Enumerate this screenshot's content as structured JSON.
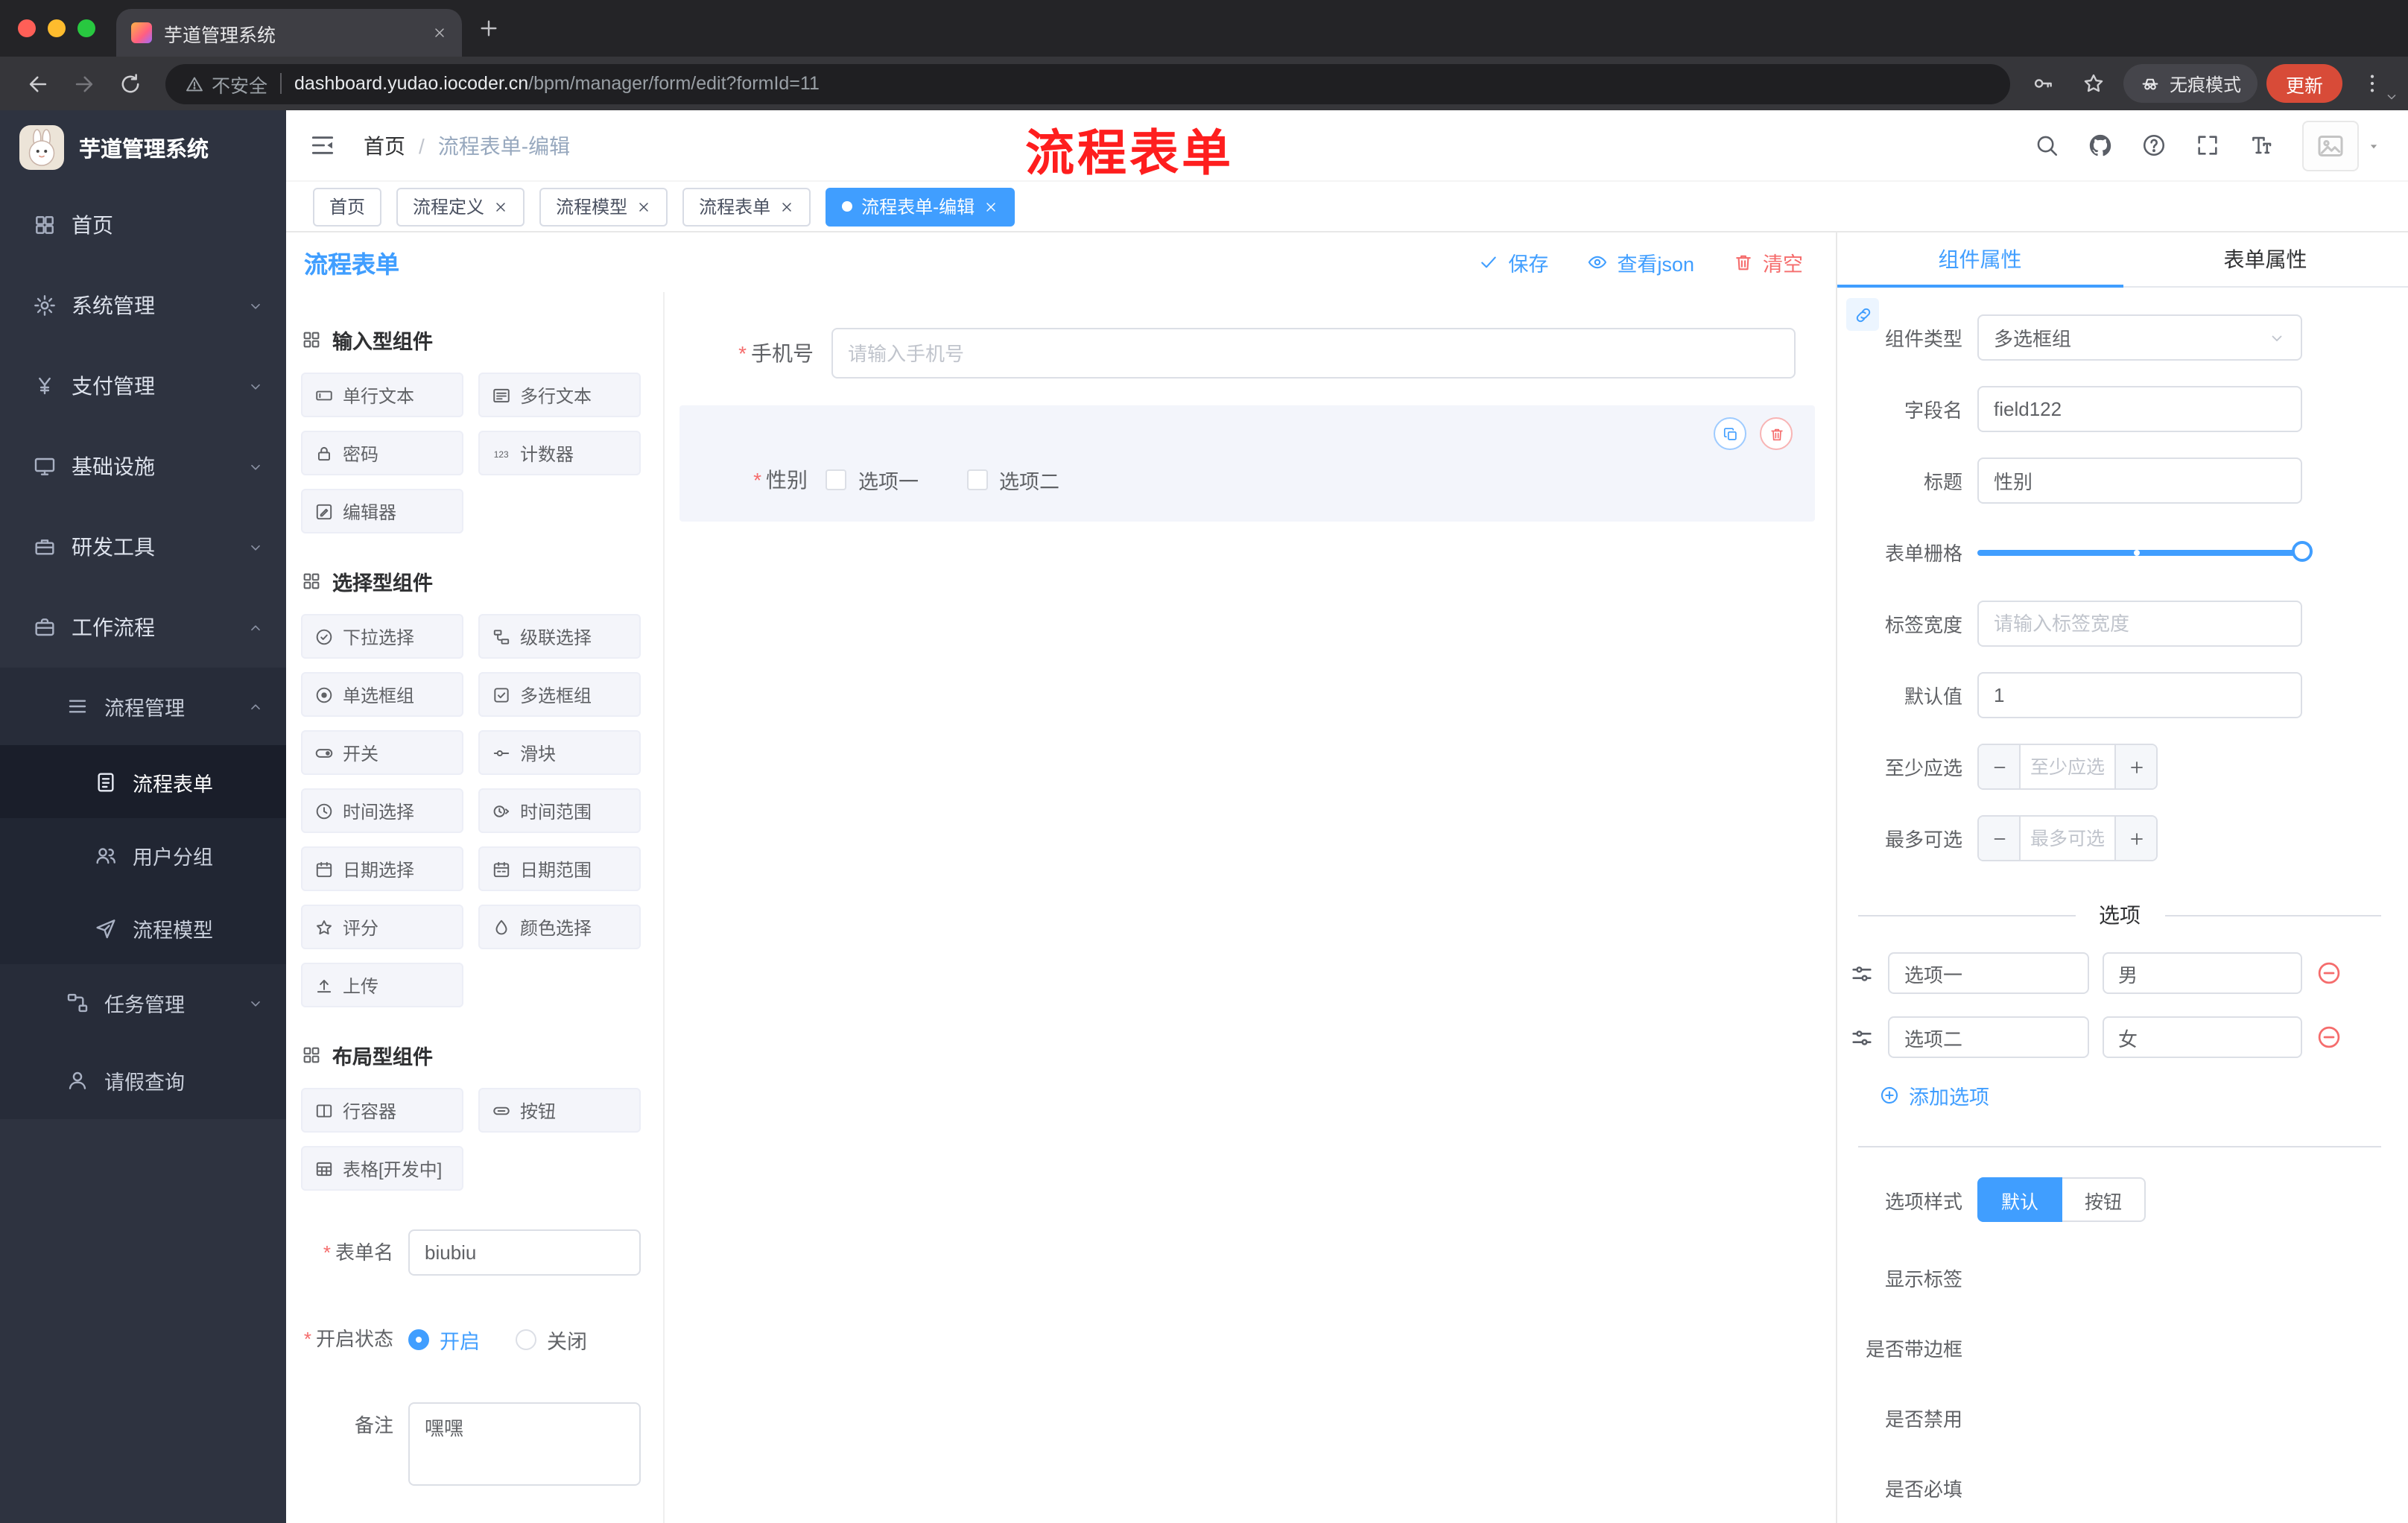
{
  "colors": {
    "accent": "#409eff",
    "danger": "#f56c6c",
    "annotation": "#fe1e1e"
  },
  "browser": {
    "tab_title": "芋道管理系统",
    "security_label": "不安全",
    "url_host": "dashboard.yudao.iocoder.cn",
    "url_path": "/bpm/manager/form/edit?formId=11",
    "incognito_label": "无痕模式",
    "update_label": "更新"
  },
  "sidebar": {
    "logo_title": "芋道管理系统",
    "items": [
      {
        "label": "首页",
        "icon": "dashboard",
        "level": 0,
        "chevron": ""
      },
      {
        "label": "系统管理",
        "icon": "gear",
        "level": 0,
        "chevron": "chevron-down"
      },
      {
        "label": "支付管理",
        "icon": "yen",
        "level": 0,
        "chevron": "chevron-down"
      },
      {
        "label": "基础设施",
        "icon": "monitor",
        "level": 0,
        "chevron": "chevron-down"
      },
      {
        "label": "研发工具",
        "icon": "toolbox",
        "level": 0,
        "chevron": "chevron-down"
      },
      {
        "label": "工作流程",
        "icon": "briefcase",
        "level": 0,
        "chevron": "chevron-up",
        "expanded": true
      },
      {
        "label": "流程管理",
        "icon": "list",
        "level": 1,
        "chevron": "chevron-up",
        "expanded": true
      },
      {
        "label": "流程表单",
        "icon": "document",
        "level": 2,
        "chevron": "",
        "active": true
      },
      {
        "label": "用户分组",
        "icon": "users",
        "level": 2,
        "chevron": ""
      },
      {
        "label": "流程模型",
        "icon": "send",
        "level": 2,
        "chevron": ""
      },
      {
        "label": "任务管理",
        "icon": "flow",
        "level": 1,
        "chevron": "chevron-down"
      },
      {
        "label": "请假查询",
        "icon": "user",
        "level": 1,
        "chevron": ""
      }
    ]
  },
  "header": {
    "breadcrumb_home": "首页",
    "breadcrumb_sep": "/",
    "breadcrumb_current": "流程表单-编辑",
    "annotation": "流程表单"
  },
  "tags": [
    {
      "label": "首页",
      "closable": false,
      "active": false
    },
    {
      "label": "流程定义",
      "closable": true,
      "active": false
    },
    {
      "label": "流程模型",
      "closable": true,
      "active": false
    },
    {
      "label": "流程表单",
      "closable": true,
      "active": false
    },
    {
      "label": "流程表单-编辑",
      "closable": true,
      "active": true
    }
  ],
  "toolbar": {
    "title": "流程表单",
    "save_label": "保存",
    "view_json_label": "查看json",
    "clear_label": "清空"
  },
  "palette": {
    "input_title": "输入型组件",
    "input_items": [
      {
        "icon": "text-field",
        "label": "单行文本"
      },
      {
        "icon": "textarea",
        "label": "多行文本"
      },
      {
        "icon": "lock",
        "label": "密码"
      },
      {
        "icon": "counter",
        "label": "计数器"
      },
      {
        "icon": "editor",
        "label": "编辑器"
      }
    ],
    "select_title": "选择型组件",
    "select_items": [
      {
        "icon": "select-ic",
        "label": "下拉选择"
      },
      {
        "icon": "cascader-ic",
        "label": "级联选择"
      },
      {
        "icon": "radio-ic",
        "label": "单选框组"
      },
      {
        "icon": "checkbox-ic",
        "label": "多选框组"
      },
      {
        "icon": "switch-ic",
        "label": "开关"
      },
      {
        "icon": "slider-ic",
        "label": "滑块"
      },
      {
        "icon": "time-ic",
        "label": "时间选择"
      },
      {
        "icon": "time-range-ic",
        "label": "时间范围"
      },
      {
        "icon": "date-ic",
        "label": "日期选择"
      },
      {
        "icon": "date-range-ic",
        "label": "日期范围"
      },
      {
        "icon": "rate-ic",
        "label": "评分"
      },
      {
        "icon": "color-ic",
        "label": "颜色选择"
      },
      {
        "icon": "upload-ic",
        "label": "上传"
      }
    ],
    "layout_title": "布局型组件",
    "layout_items": [
      {
        "icon": "row-ic",
        "label": "行容器"
      },
      {
        "icon": "button-ic",
        "label": "按钮"
      },
      {
        "icon": "table-ic",
        "label": "表格[开发中]"
      }
    ],
    "form": {
      "name_label": "表单名",
      "name_value": "biubiu",
      "status_label": "开启状态",
      "status_on": "开启",
      "status_off": "关闭",
      "remark_label": "备注",
      "remark_value": "嘿嘿"
    }
  },
  "canvas": {
    "phone_label": "手机号",
    "phone_placeholder": "请输入手机号",
    "gender_label": "性别",
    "gender_opt1": "选项一",
    "gender_opt2": "选项二"
  },
  "props": {
    "tab_component": "组件属性",
    "tab_form": "表单属性",
    "type_label": "组件类型",
    "type_value": "多选框组",
    "field_label": "字段名",
    "field_value": "field122",
    "title_label": "标题",
    "title_value": "性别",
    "grid_label": "表单栅格",
    "width_label": "标签宽度",
    "width_placeholder": "请输入标签宽度",
    "default_label": "默认值",
    "default_value": "1",
    "min_label": "至少应选",
    "min_placeholder": "至少应选",
    "max_label": "最多可选",
    "max_placeholder": "最多可选",
    "options_title": "选项",
    "options": [
      {
        "label": "选项一",
        "value": "男"
      },
      {
        "label": "选项二",
        "value": "女"
      }
    ],
    "add_option_label": "添加选项",
    "style_label": "选项样式",
    "style_default": "默认",
    "style_button": "按钮",
    "show_label_label": "显示标签",
    "border_label": "是否带边框",
    "disabled_label": "是否禁用",
    "required_label": "是否必填"
  }
}
